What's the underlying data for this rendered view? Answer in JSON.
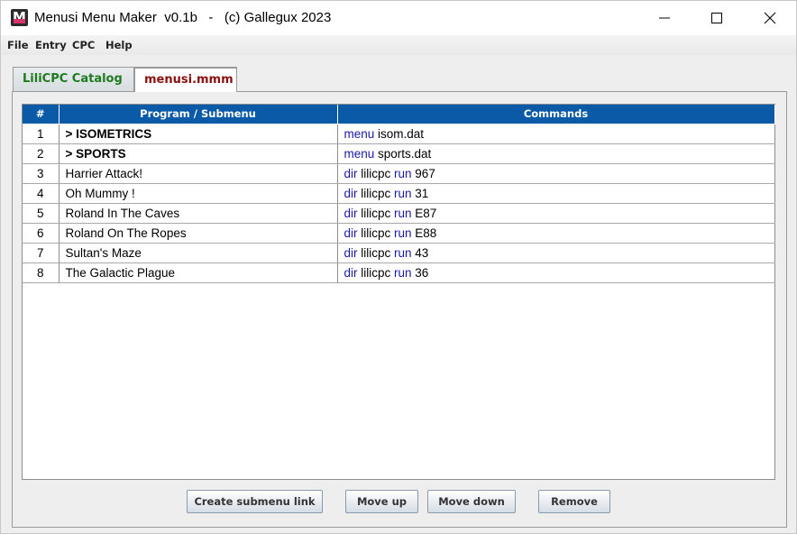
{
  "window": {
    "title": "Menusi Menu Maker  v0.1b   -   (c) Gallegux 2023",
    "icon_letter": "M"
  },
  "menu": {
    "items": [
      "File",
      "Entry",
      "CPC",
      "Help"
    ]
  },
  "tabs": [
    {
      "label": "LiliCPC Catalog",
      "selected": false,
      "color": "#1f7a1f"
    },
    {
      "label": "menusi.mmm",
      "selected": true,
      "color": "#8a1010"
    }
  ],
  "table": {
    "headers": [
      "#",
      "Program / Submenu",
      "Commands"
    ],
    "header_color": "#0b5aa8",
    "keyword_color": "#1a1aa6",
    "rows": [
      {
        "num": "1",
        "name": "> ISOMETRICS",
        "bold": true,
        "cmd": [
          {
            "kw": "menu"
          },
          {
            "t": " isom.dat"
          }
        ]
      },
      {
        "num": "2",
        "name": "> SPORTS",
        "bold": true,
        "cmd": [
          {
            "kw": "menu"
          },
          {
            "t": " sports.dat"
          }
        ]
      },
      {
        "num": "3",
        "name": "Harrier Attack!",
        "bold": false,
        "cmd": [
          {
            "kw": "dir"
          },
          {
            "t": " lilicpc "
          },
          {
            "kw": "run"
          },
          {
            "t": " 967"
          }
        ]
      },
      {
        "num": "4",
        "name": "Oh Mummy !",
        "bold": false,
        "cmd": [
          {
            "kw": "dir"
          },
          {
            "t": " lilicpc "
          },
          {
            "kw": "run"
          },
          {
            "t": " 31"
          }
        ]
      },
      {
        "num": "5",
        "name": "Roland In The Caves",
        "bold": false,
        "cmd": [
          {
            "kw": "dir"
          },
          {
            "t": " lilicpc "
          },
          {
            "kw": "run"
          },
          {
            "t": " E87"
          }
        ]
      },
      {
        "num": "6",
        "name": "Roland On The Ropes",
        "bold": false,
        "cmd": [
          {
            "kw": "dir"
          },
          {
            "t": " lilicpc "
          },
          {
            "kw": "run"
          },
          {
            "t": " E88"
          }
        ]
      },
      {
        "num": "7",
        "name": "Sultan's Maze",
        "bold": false,
        "cmd": [
          {
            "kw": "dir"
          },
          {
            "t": " lilicpc "
          },
          {
            "kw": "run"
          },
          {
            "t": " 43"
          }
        ]
      },
      {
        "num": "8",
        "name": "The Galactic Plague",
        "bold": false,
        "cmd": [
          {
            "kw": "dir"
          },
          {
            "t": " lilicpc "
          },
          {
            "kw": "run"
          },
          {
            "t": " 36"
          }
        ]
      }
    ]
  },
  "buttons": {
    "create_submenu": "Create submenu link",
    "move_up": "Move up",
    "move_down": "Move down",
    "remove": "Remove"
  },
  "icons": {
    "minimize": "minimize-icon",
    "maximize": "maximize-icon",
    "close": "close-icon"
  }
}
